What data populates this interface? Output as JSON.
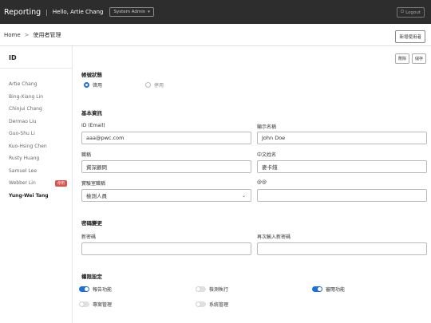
{
  "topbar": {
    "brand": "Reporting",
    "separator": "|",
    "greeting": "Hello, Artie Chang",
    "role": "System Admin",
    "logout": "Logout"
  },
  "breadcrumb": {
    "home": "Home",
    "separator": ">",
    "current": "使用者管理"
  },
  "new_user_button": "新增使用者",
  "sidebar": {
    "header": "ID",
    "users": [
      {
        "name": "Artie Chang",
        "tag": ""
      },
      {
        "name": "Bing-Xiang Lin",
        "tag": ""
      },
      {
        "name": "Chinjui Chang",
        "tag": ""
      },
      {
        "name": "Dermao Liu",
        "tag": ""
      },
      {
        "name": "Guo-Shu Li",
        "tag": ""
      },
      {
        "name": "Kuo-Hsing Chen",
        "tag": ""
      },
      {
        "name": "Rusty Huang",
        "tag": ""
      },
      {
        "name": "Samuel Lee",
        "tag": ""
      },
      {
        "name": "Webber Lin",
        "tag": "停用"
      },
      {
        "name": "Yung-Wei Tang",
        "tag": ""
      }
    ]
  },
  "actions": {
    "delete": "刪除",
    "save": "儲存"
  },
  "account_status": {
    "title": "帳號狀態",
    "enabled": "啓用",
    "disabled": "停用"
  },
  "basic_info": {
    "title": "基本資訊",
    "id_label": "ID (Email)",
    "id_value": "aaa@pwc.com",
    "display_name_label": "顯示名稱",
    "display_name_value": "John Doe",
    "job_title_label": "職稱",
    "job_title_value": "資深顧問",
    "chinese_name_label": "中文姓名",
    "chinese_name_value": "麥卡錢",
    "lab_role_label": "實驗室職稱",
    "lab_role_value": "檢測人員",
    "at_label": "@@",
    "at_value": ""
  },
  "password": {
    "title": "密碼變更",
    "new_label": "新密碼",
    "confirm_label": "再次輸入新密碼"
  },
  "permissions": {
    "title": "權限設定",
    "items": [
      {
        "label": "報告功能",
        "on": true
      },
      {
        "label": "檢測執行",
        "on": false
      },
      {
        "label": "審閱功能",
        "on": true
      },
      {
        "label": "專案管理",
        "on": false
      },
      {
        "label": "系統管理",
        "on": false
      }
    ]
  }
}
